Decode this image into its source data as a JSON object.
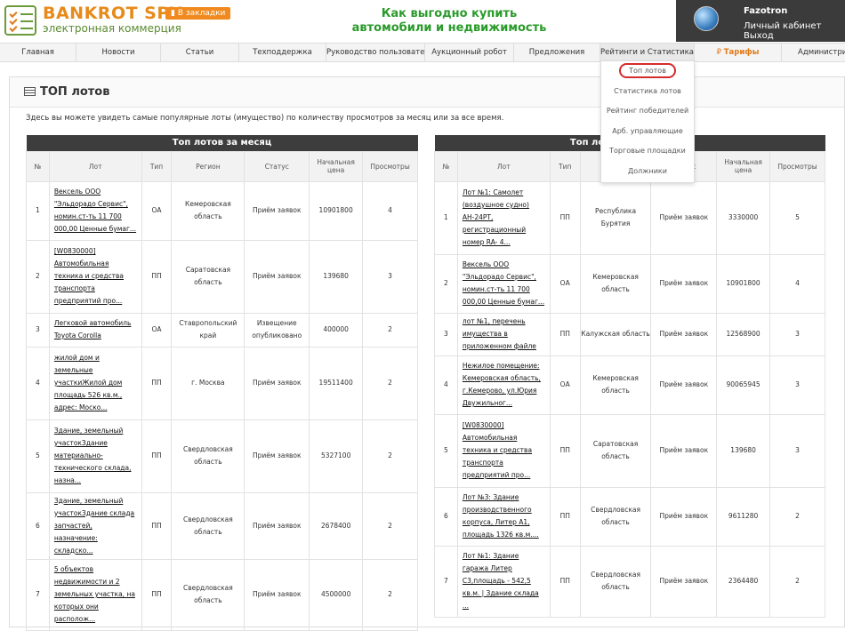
{
  "header": {
    "brand": "BANKROT SPY",
    "brand_sub": "электронная коммерция",
    "bookmark_label": "В закладки",
    "promo_line1": "Как выгодно купить",
    "promo_line2": "автомобили и недвижимость",
    "user_name": "Fazotron",
    "cabinet_link": "Личный кабинет",
    "logout_link": "Выход"
  },
  "nav": [
    "Главная",
    "Новости",
    "Статьи",
    "Техподдержка",
    "Руководство пользователя",
    "Аукционный робот",
    "Предложения",
    "Рейтинги и Статистика",
    "Тарифы",
    "Администрирование"
  ],
  "dropdown": [
    "Топ лотов",
    "Статистика лотов",
    "Рейтинг победителей",
    "Арб. управляющие",
    "Торговые площадки",
    "Должники"
  ],
  "page": {
    "title": "ТОП лотов",
    "description": "Здесь вы можете увидеть самые популярные лоты (имущество) по количеству просмотров за месяц или за все время."
  },
  "columns": [
    "№",
    "Лот",
    "Тип",
    "Регион",
    "Статус",
    "Начальная цена",
    "Просмотры"
  ],
  "table_month": {
    "caption": "Топ лотов за месяц",
    "rows": [
      {
        "n": "1",
        "lot": "Вексель ООО \"Эльдорадо Сервис\", номин.ст-ть 11 700 000,00 Ценные бумаг...",
        "type": "ОА",
        "region": "Кемеровская область",
        "status": "Приём заявок",
        "price": "10901800",
        "views": "4"
      },
      {
        "n": "2",
        "lot": "[W0830000] Автомобильная техника и средства транспорта предприятий про...",
        "type": "ПП",
        "region": "Саратовская область",
        "status": "Приём заявок",
        "price": "139680",
        "views": "3"
      },
      {
        "n": "3",
        "lot": "Легковой автомобиль Toyota Corolla",
        "type": "ОА",
        "region": "Ставропольский край",
        "status": "Извещение опубликовано",
        "price": "400000",
        "views": "2"
      },
      {
        "n": "4",
        "lot": "жилой дом и земельные участкиЖилой дом площадь 526 кв.м., адрес: Моско...",
        "type": "ПП",
        "region": "г. Москва",
        "status": "Приём заявок",
        "price": "19511400",
        "views": "2"
      },
      {
        "n": "5",
        "lot": "Здание, земельный участокЗдание материально-технического склада, назна...",
        "type": "ПП",
        "region": "Свердловская область",
        "status": "Приём заявок",
        "price": "5327100",
        "views": "2"
      },
      {
        "n": "6",
        "lot": "Здание, земельный участокЗдание склада запчастей, назначение: складско...",
        "type": "ПП",
        "region": "Свердловская область",
        "status": "Приём заявок",
        "price": "2678400",
        "views": "2"
      },
      {
        "n": "7",
        "lot": "5 объектов недвижимости и 2 земельных участка, на которых они располож...",
        "type": "ПП",
        "region": "Свердловская область",
        "status": "Приём заявок",
        "price": "4500000",
        "views": "2"
      }
    ]
  },
  "table_all": {
    "caption": "Топ лотов за все время",
    "rows": [
      {
        "n": "1",
        "lot": "Лот №1: Самолет (воздушное судно) АН-24РТ, регистрационный номер RA- 4...",
        "type": "ПП",
        "region": "Республика Бурятия",
        "status": "Приём заявок",
        "price": "3330000",
        "views": "5"
      },
      {
        "n": "2",
        "lot": "Вексель ООО \"Эльдорадо Сервис\", номин.ст-ть 11 700 000,00 Ценные бумаг...",
        "type": "ОА",
        "region": "Кемеровская область",
        "status": "Приём заявок",
        "price": "10901800",
        "views": "4"
      },
      {
        "n": "3",
        "lot": "лот №1, перечень имущества в приложенном файле",
        "type": "ПП",
        "region": "Калужская область",
        "status": "Приём заявок",
        "price": "12568900",
        "views": "3"
      },
      {
        "n": "4",
        "lot": "Нежилое помещение: Кемеровская область, г.Кемерово, ул.Юрия Двужильног...",
        "type": "ОА",
        "region": "Кемеровская область",
        "status": "Приём заявок",
        "price": "90065945",
        "views": "3"
      },
      {
        "n": "5",
        "lot": "[W0830000] Автомобильная техника и средства транспорта предприятий про...",
        "type": "ПП",
        "region": "Саратовская область",
        "status": "Приём заявок",
        "price": "139680",
        "views": "3"
      },
      {
        "n": "6",
        "lot": "Лот №3: Здание производственного корпуса, Литер А1, площадь 1326 кв.м....",
        "type": "ПП",
        "region": "Свердловская область",
        "status": "Приём заявок",
        "price": "9611280",
        "views": "2"
      },
      {
        "n": "7",
        "lot": "Лот №1: Здание гаража Литер С3,площадь - 542,5 кв.м. | Здание склада ...",
        "type": "ПП",
        "region": "Свердловская область",
        "status": "Приём заявок",
        "price": "2364480",
        "views": "2"
      }
    ]
  }
}
